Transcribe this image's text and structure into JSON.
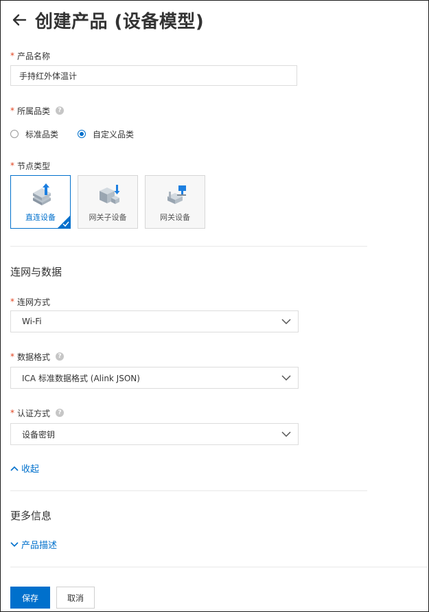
{
  "header": {
    "title": "创建产品 (设备模型)"
  },
  "product_name": {
    "label": "产品名称",
    "value": "手持红外体温计"
  },
  "category": {
    "label": "所属品类",
    "options": [
      {
        "label": "标准品类",
        "checked": false
      },
      {
        "label": "自定义品类",
        "checked": true
      }
    ]
  },
  "node_type": {
    "label": "节点类型",
    "cards": [
      {
        "label": "直连设备",
        "selected": true
      },
      {
        "label": "网关子设备",
        "selected": false
      },
      {
        "label": "网关设备",
        "selected": false
      }
    ]
  },
  "network_section": {
    "title": "连网与数据",
    "connection": {
      "label": "连网方式",
      "value": "Wi-Fi"
    },
    "data_format": {
      "label": "数据格式",
      "value": "ICA 标准数据格式 (Alink JSON)"
    },
    "auth": {
      "label": "认证方式",
      "value": "设备密钥"
    },
    "collapse_label": "收起"
  },
  "more_section": {
    "title": "更多信息",
    "description_label": "产品描述"
  },
  "footer": {
    "save_label": "保存",
    "cancel_label": "取消"
  },
  "colors": {
    "primary": "#0070cc",
    "required": "#e0431f"
  },
  "icons": {
    "back": "arrow-left-icon",
    "help": "question-circle-icon",
    "chevron": "chevron-down-icon",
    "collapse": "chevron-up-icon"
  }
}
